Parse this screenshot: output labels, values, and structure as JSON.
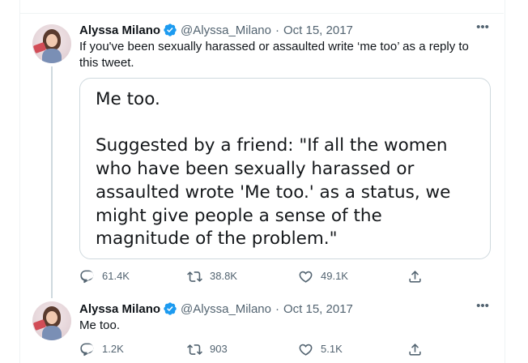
{
  "tweets": [
    {
      "author_name": "Alyssa Milano",
      "handle": "@Alyssa_Milano",
      "separator": "·",
      "date": "Oct 15, 2017",
      "text": "If you've been sexually harassed or assaulted write ‘me too’ as a reply to this tweet.",
      "card": {
        "line1": "Me too.",
        "line2": "Suggested by a friend: \"If all the women who have been sexually harassed or assaulted wrote 'Me too.' as a status, we might give people a sense of the magnitude of the problem.\""
      },
      "replies": "61.4K",
      "retweets": "38.8K",
      "likes": "49.1K"
    },
    {
      "author_name": "Alyssa Milano",
      "handle": "@Alyssa_Milano",
      "separator": "·",
      "date": "Oct 15, 2017",
      "text": "Me too.",
      "replies": "1.2K",
      "retweets": "903",
      "likes": "5.1K"
    }
  ],
  "icons": {
    "verified": "verified-badge-icon",
    "more": "more-options-icon",
    "reply": "reply-icon",
    "retweet": "retweet-icon",
    "like": "like-icon",
    "share": "share-icon"
  },
  "colors": {
    "verified_blue": "#1d9bf0",
    "muted_text": "#536471",
    "border": "#cfd9de"
  }
}
